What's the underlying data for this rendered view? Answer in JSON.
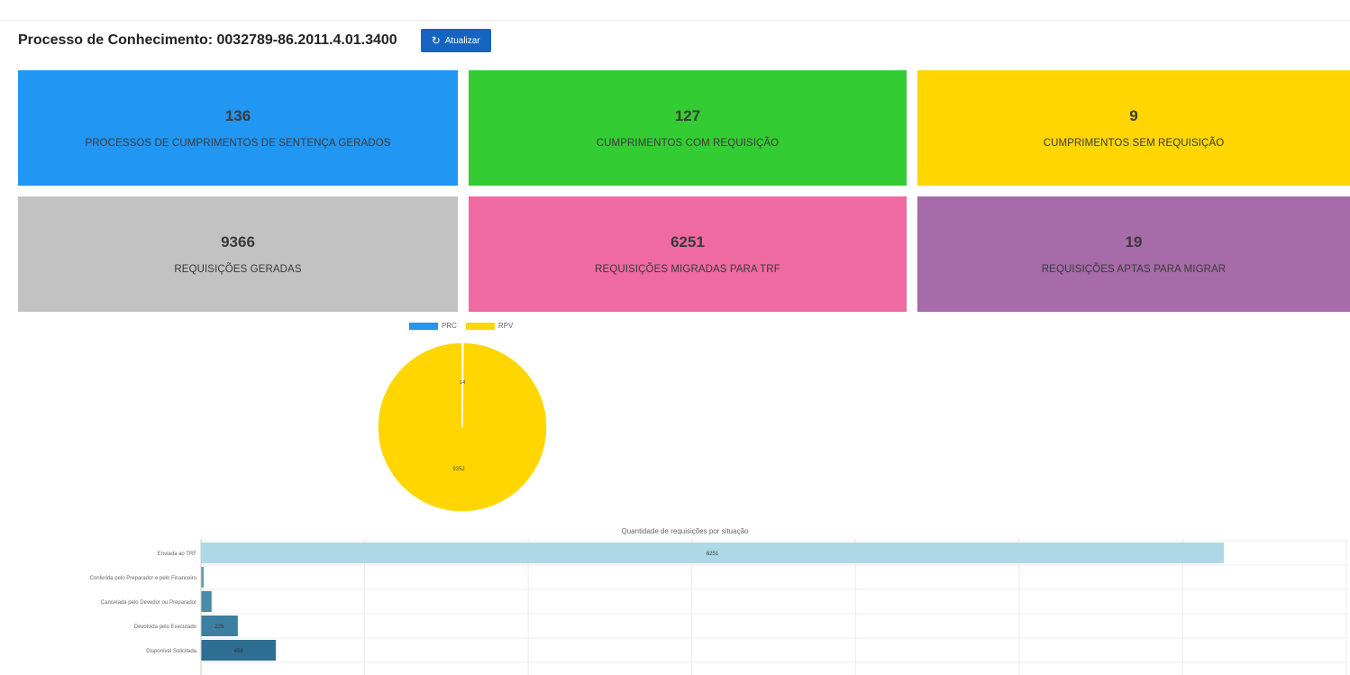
{
  "header": {
    "title": "Processo de Conhecimento: 0032789-86.2011.4.01.3400",
    "refresh_label": "Atualizar",
    "refresh_icon": "refresh-icon"
  },
  "cards": [
    {
      "value": "136",
      "label": "PROCESSOS DE CUMPRIMENTOS DE SENTENÇA GERADOS",
      "color": "#2196f3"
    },
    {
      "value": "127",
      "label": "CUMPRIMENTOS COM REQUISIÇÃO",
      "color": "#33cc33"
    },
    {
      "value": "9",
      "label": "CUMPRIMENTOS SEM REQUISIÇÃO",
      "color": "#ffd600"
    },
    {
      "value": "9366",
      "label": "REQUISIÇÕES GERADAS",
      "color": "#c2c2c2"
    },
    {
      "value": "6251",
      "label": "REQUISIÇÕES MIGRADAS PARA TRF",
      "color": "#ef6aa0"
    },
    {
      "value": "19",
      "label": "REQUISIÇÕES APTAS PARA MIGRAR",
      "color": "#a66ba8"
    }
  ],
  "chart_data": [
    {
      "type": "pie",
      "legend": [
        "PRC",
        "RPV"
      ],
      "colors": [
        "#2196f3",
        "#ffd600"
      ],
      "values": [
        14,
        9352
      ],
      "labels": [
        "14",
        "9352"
      ],
      "legend_position": "top"
    },
    {
      "type": "bar",
      "orientation": "horizontal",
      "title": "Quantidade de requisições por situação",
      "categories": [
        "Enviada ao TRF",
        "Conferida pelo Preparador e pelo Financeiro",
        "Cancelada pelo Devedor ou Preparador",
        "Devolvida pelo Executado",
        "Disponível Solicitada"
      ],
      "values": [
        6251,
        15,
        65,
        225,
        458
      ],
      "labels": [
        "6251",
        "",
        "",
        "225",
        "458"
      ],
      "colors": [
        "#add8e6",
        "#5f9ab5",
        "#4a8aaa",
        "#3d7fa0",
        "#2e6e92"
      ],
      "xlim": [
        0,
        7000
      ],
      "grid": true
    }
  ]
}
